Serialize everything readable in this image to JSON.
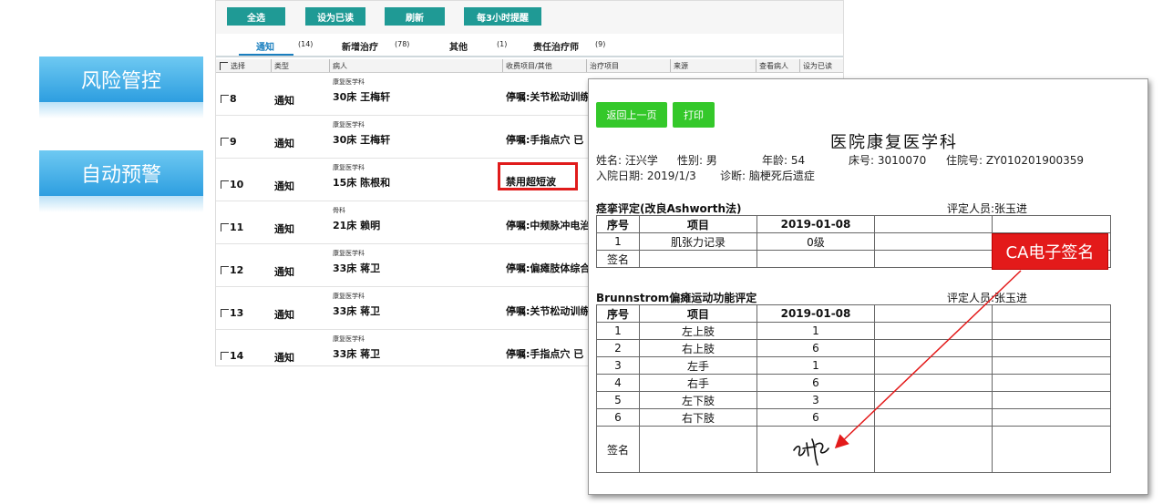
{
  "side_buttons": [
    {
      "label": "风险管控"
    },
    {
      "label": "自动预警"
    }
  ],
  "toolbar": {
    "select_all": "全选",
    "mark_read": "设为已读",
    "refresh": "刷新",
    "remind_3h": "每3小时提醒"
  },
  "tabs": [
    {
      "label": "通知",
      "count": "(14)"
    },
    {
      "label": "新增治疗",
      "count": "(78)"
    },
    {
      "label": "其他",
      "count": "(1)"
    },
    {
      "label": "责任治疗师",
      "count": "(9)"
    }
  ],
  "list_headers": [
    "选择",
    "类型",
    "病人",
    "收费项目/其他",
    "治疗项目",
    "来源",
    "查看病人",
    "设为已读"
  ],
  "rows": [
    {
      "num": "8",
      "type": "通知",
      "dept": "康复医学科",
      "bed": "30床 王梅轩",
      "item": "停嘱:关节松动训练"
    },
    {
      "num": "9",
      "type": "通知",
      "dept": "康复医学科",
      "bed": "30床 王梅轩",
      "item": "停嘱:手指点穴 已"
    },
    {
      "num": "10",
      "type": "通知",
      "dept": "康复医学科",
      "bed": "15床 陈根和",
      "item": "禁用超短波"
    },
    {
      "num": "11",
      "type": "通知",
      "dept": "骨科",
      "bed": "21床 赖明",
      "item": "停嘱:中频脉冲电治"
    },
    {
      "num": "12",
      "type": "通知",
      "dept": "康复医学科",
      "bed": "33床 蒋卫",
      "item": "停嘱:偏瘫肢体综合"
    },
    {
      "num": "13",
      "type": "通知",
      "dept": "康复医学科",
      "bed": "33床 蒋卫",
      "item": "停嘱:关节松动训练"
    },
    {
      "num": "14",
      "type": "通知",
      "dept": "康复医学科",
      "bed": "33床 蒋卫",
      "item": "停嘱:手指点穴 已"
    }
  ],
  "report": {
    "back_button": "返回上一页",
    "print_button": "打印",
    "title": "医院康复医学科",
    "name": "姓名: 汪兴学",
    "gender": "性别: 男",
    "age": "年龄: 54",
    "bed": "床号: 3010070",
    "inpatient_no": "住院号: ZY010201900359",
    "admit_date": "入院日期: 2019/1/3",
    "diagnosis": "诊断: 脑梗死后遗症",
    "section1": {
      "title": "痉挛评定(改良Ashworth法)",
      "assessor": "评定人员:张玉进",
      "headers": [
        "序号",
        "项目",
        "2019-01-08"
      ],
      "rows": [
        {
          "no": "1",
          "item": "肌张力记录",
          "val": "0级"
        }
      ],
      "sign_label": "签名"
    },
    "section2": {
      "title": "Brunnstrom偏瘫运动功能评定",
      "assessor": "评定人员:张玉进",
      "headers": [
        "序号",
        "项目",
        "2019-01-08"
      ],
      "rows": [
        {
          "no": "1",
          "item": "左上肢",
          "val": "1"
        },
        {
          "no": "2",
          "item": "右上肢",
          "val": "6"
        },
        {
          "no": "3",
          "item": "左手",
          "val": "1"
        },
        {
          "no": "4",
          "item": "右手",
          "val": "6"
        },
        {
          "no": "5",
          "item": "左下肢",
          "val": "3"
        },
        {
          "no": "6",
          "item": "右下肢",
          "val": "6"
        }
      ],
      "sign_label": "签名"
    }
  },
  "callout": {
    "label": "CA电子签名",
    "color": "#e31a1a"
  }
}
